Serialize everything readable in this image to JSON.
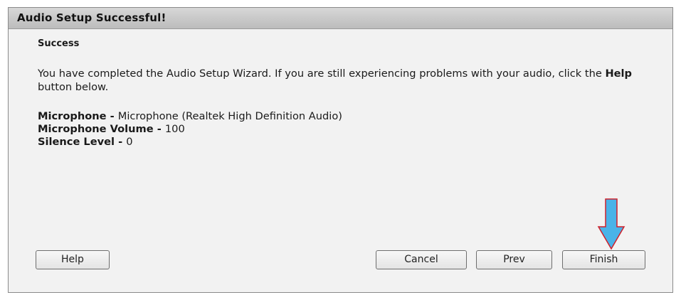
{
  "window": {
    "title": "Audio Setup Successful!"
  },
  "content": {
    "heading": "Success",
    "message_part1": "You have completed the Audio Setup Wizard. If you are still experiencing problems with your audio, click the ",
    "message_bold": "Help",
    "message_part2": " button below.",
    "details": [
      {
        "label": "Microphone - ",
        "value": "Microphone (Realtek High Definition Audio)"
      },
      {
        "label": "Microphone Volume - ",
        "value": "100"
      },
      {
        "label": "Silence Level - ",
        "value": "0"
      }
    ]
  },
  "buttons": {
    "help": "Help",
    "cancel": "Cancel",
    "prev": "Prev",
    "finish": "Finish"
  },
  "annotation": {
    "arrow_color": "#4ab3e8",
    "arrow_outline": "#d0202a",
    "arrow_icon": "down-arrow-icon"
  }
}
